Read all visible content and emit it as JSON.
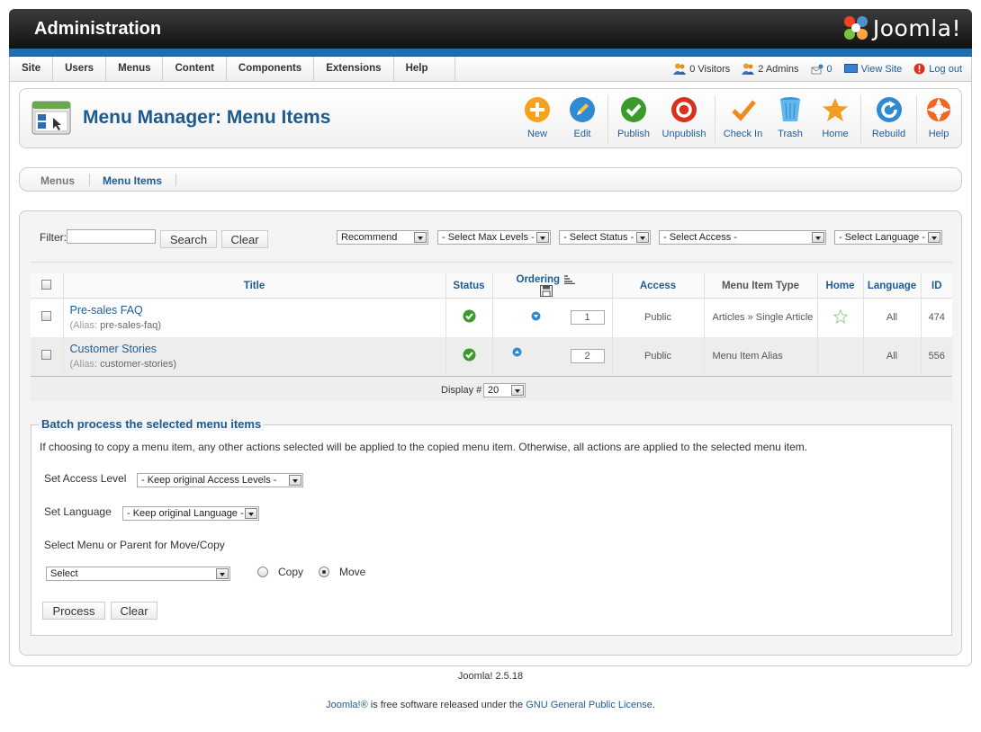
{
  "header": {
    "title": "Administration",
    "logo_text": "Joomla!"
  },
  "menu": [
    "Site",
    "Users",
    "Menus",
    "Content",
    "Components",
    "Extensions",
    "Help"
  ],
  "status": {
    "visitors": "0 Visitors",
    "admins": "2 Admins",
    "messages": "0",
    "view_site": "View Site",
    "logout": "Log out"
  },
  "page": {
    "title": "Menu Manager: Menu Items"
  },
  "toolbar": {
    "new": "New",
    "edit": "Edit",
    "publish": "Publish",
    "unpublish": "Unpublish",
    "checkin": "Check In",
    "trash": "Trash",
    "home": "Home",
    "rebuild": "Rebuild",
    "help": "Help"
  },
  "submenu": {
    "menus": "Menus",
    "menu_items": "Menu Items"
  },
  "filter": {
    "label": "Filter:",
    "value": "",
    "search": "Search",
    "clear": "Clear",
    "menu": "Recommend",
    "max_levels": "- Select Max Levels -",
    "status": "- Select Status -",
    "access": "- Select Access -",
    "language": "- Select Language -"
  },
  "table": {
    "headers": {
      "title": "Title",
      "status": "Status",
      "ordering": "Ordering",
      "access": "Access",
      "type": "Menu Item Type",
      "home": "Home",
      "language": "Language",
      "id": "ID"
    },
    "rows": [
      {
        "title": "Pre-sales FAQ",
        "alias_label": "(Alias:",
        "alias": "pre-sales-faq)",
        "order": "1",
        "access": "Public",
        "type": "Articles » Single Article",
        "language": "All",
        "id": "474"
      },
      {
        "title": "Customer Stories",
        "alias_label": "(Alias:",
        "alias": "customer-stories)",
        "order": "2",
        "access": "Public",
        "type": "Menu Item Alias",
        "language": "All",
        "id": "556"
      }
    ],
    "display_label": "Display #",
    "display_value": "20"
  },
  "batch": {
    "legend": "Batch process the selected menu items",
    "tip": "If choosing to copy a menu item, any other actions selected will be applied to the copied menu item. Otherwise, all actions are applied to the selected menu item.",
    "access_label": "Set Access Level",
    "access_value": "- Keep original Access Levels -",
    "language_label": "Set Language",
    "language_value": "- Keep original Language -",
    "move_label": "Select Menu or Parent for Move/Copy",
    "move_value": "Select",
    "copy": "Copy",
    "move": "Move",
    "process": "Process",
    "clear": "Clear"
  },
  "footer": {
    "version": "Joomla! 2.5.18",
    "joomla_link": "Joomla!®",
    "text": " is free software released under the ",
    "license_link": "GNU General Public License",
    "end": "."
  }
}
